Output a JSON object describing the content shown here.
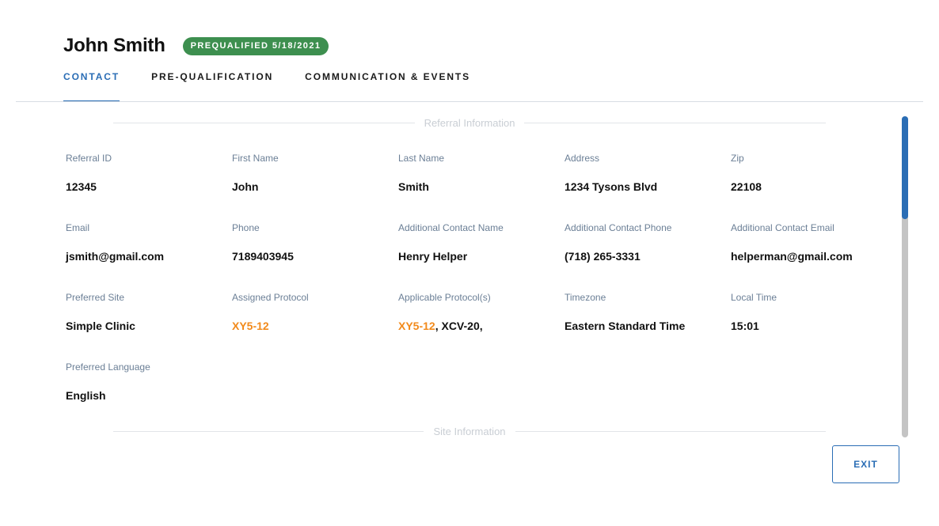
{
  "header": {
    "name": "John Smith",
    "badge": "PREQUALIFIED 5/18/2021"
  },
  "tabs": [
    {
      "label": "CONTACT",
      "active": true
    },
    {
      "label": "PRE-QUALIFICATION",
      "active": false
    },
    {
      "label": "COMMUNICATION & EVENTS",
      "active": false
    }
  ],
  "sections": {
    "referral": "Referral Information",
    "site": "Site Information"
  },
  "fields": {
    "referral_id": {
      "label": "Referral ID",
      "value": "12345"
    },
    "first_name": {
      "label": "First Name",
      "value": "John"
    },
    "last_name": {
      "label": "Last Name",
      "value": "Smith"
    },
    "address": {
      "label": "Address",
      "value": "1234 Tysons Blvd"
    },
    "zip": {
      "label": "Zip",
      "value": "22108"
    },
    "email": {
      "label": "Email",
      "value": "jsmith@gmail.com"
    },
    "phone": {
      "label": "Phone",
      "value": "7189403945"
    },
    "additional_contact_name": {
      "label": "Additional Contact Name",
      "value": "Henry Helper"
    },
    "additional_contact_phone": {
      "label": "Additional Contact Phone",
      "value": "(718) 265-3331"
    },
    "additional_contact_email": {
      "label": "Additional Contact Email",
      "value": "helperman@gmail.com"
    },
    "preferred_site": {
      "label": "Preferred Site",
      "value": "Simple Clinic"
    },
    "assigned_protocol": {
      "label": "Assigned Protocol",
      "value": "XY5-12"
    },
    "applicable_protocols": {
      "label": "Applicable Protocol(s)",
      "highlight": "XY5-12",
      "rest": ", XCV-20,"
    },
    "timezone": {
      "label": "Timezone",
      "value": "Eastern Standard Time"
    },
    "local_time": {
      "label": "Local Time",
      "value": "15:01"
    },
    "preferred_language": {
      "label": "Preferred Language",
      "value": "English"
    }
  },
  "actions": {
    "exit": "EXIT"
  },
  "colors": {
    "accent_blue": "#2a6db5",
    "badge_green": "#3d8f4f",
    "protocol_orange": "#f28a1b"
  }
}
